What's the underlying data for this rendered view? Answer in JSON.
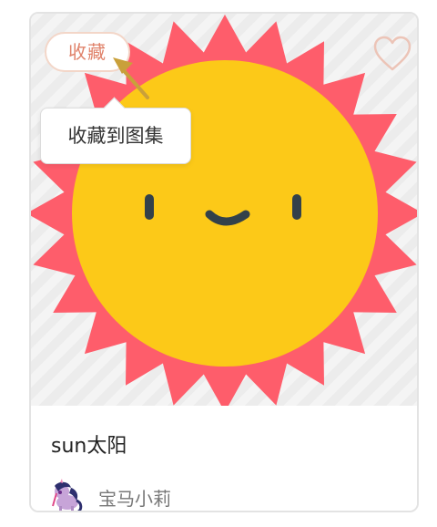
{
  "favorite": {
    "label": "收藏",
    "tooltip": "收藏到图集"
  },
  "work": {
    "title": "sun太阳",
    "author": "宝马小莉"
  },
  "icons": {
    "like": "heart-outline-icon",
    "avatar": "pony-avatar"
  },
  "colors": {
    "sun_rays": "#fe5d6b",
    "sun_face": "#fcc918",
    "face_features": "#33414a",
    "accent": "#e0826a",
    "arrow": "#c9a03a"
  }
}
